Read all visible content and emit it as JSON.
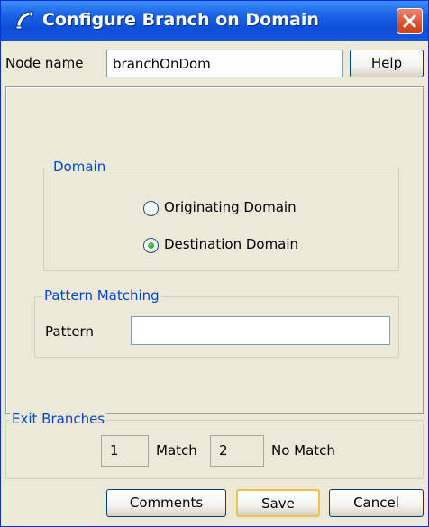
{
  "window": {
    "title": "Configure Branch on Domain"
  },
  "node": {
    "label": "Node name",
    "value": "branchOnDom",
    "help_label": "Help"
  },
  "domain_group": {
    "legend": "Domain",
    "options": [
      {
        "label": "Originating Domain",
        "selected": false
      },
      {
        "label": "Destination Domain",
        "selected": true
      }
    ]
  },
  "pattern_group": {
    "legend": "Pattern Matching",
    "label": "Pattern",
    "value": ""
  },
  "exit_group": {
    "legend": "Exit Branches",
    "branches": [
      {
        "number": "1",
        "label": "Match"
      },
      {
        "number": "2",
        "label": "No Match"
      }
    ]
  },
  "buttons": {
    "comments": "Comments",
    "save": "Save",
    "cancel": "Cancel"
  },
  "colors": {
    "titlebar": "#0b4fd8",
    "legend_text": "#0046d5",
    "close_button": "#d9532c",
    "window_bg": "#ece9d8"
  }
}
